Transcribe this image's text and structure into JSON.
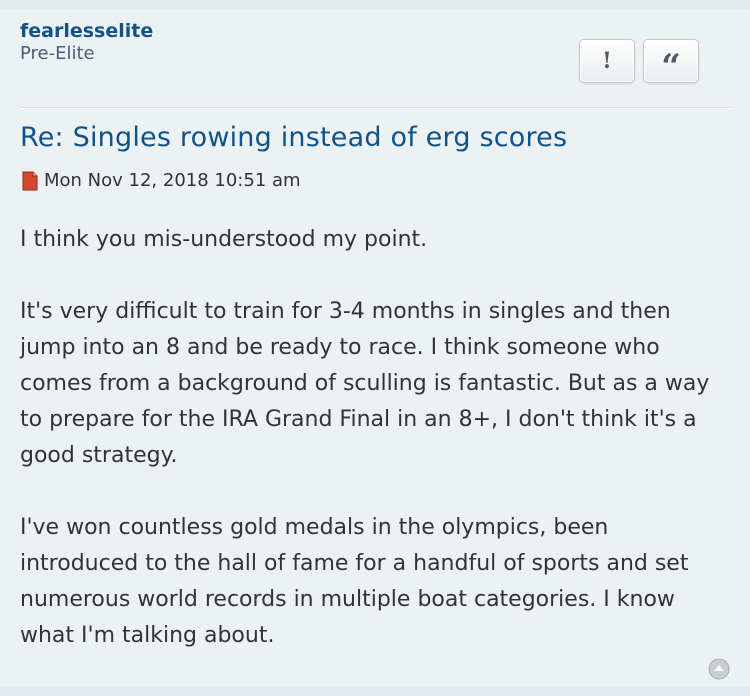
{
  "post": {
    "author": {
      "name": "fearlesselite",
      "rank": "Pre-Elite"
    },
    "buttons": {
      "report": "!",
      "quote": "“"
    },
    "title": "Re: Singles rowing instead of erg scores",
    "date": "Mon Nov 12, 2018 10:51 am",
    "paragraphs": [
      "I think you mis-understood my point.",
      "It's very difficult to train for 3-4 months in singles and then jump into an 8 and be ready to race. I think someone who comes from a background of sculling is fantastic. But as a way to prepare for the IRA Grand Final in an 8+, I don't think it's a good strategy.",
      "I've won countless gold medals in the olympics, been introduced to the hall of fame for a handful of sports and set numerous world records in multiple boat categories. I know what I'm talking about."
    ]
  },
  "icons": {
    "post_icon": "post-file-icon",
    "back_to_top": "back-to-top-icon"
  },
  "colors": {
    "link": "#105289",
    "text": "#333333",
    "rank": "#4c5d77",
    "post_bg": "#ecf1f3",
    "page_bg": "#e4ebee"
  }
}
